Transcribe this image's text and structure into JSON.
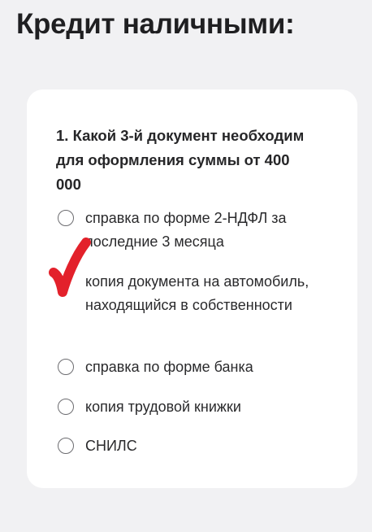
{
  "header": {
    "title": "Кредит наличными:"
  },
  "question": {
    "text": "1. Какой 3-й документ необходим для оформления суммы от 400 000",
    "options": [
      {
        "label": "справка по форме 2-НДФЛ за последние 3 месяца",
        "selected": false
      },
      {
        "label": "копия документа на автомобиль, находящийся в собственности",
        "selected": true
      },
      {
        "label": "справка по форме банка",
        "selected": false
      },
      {
        "label": "копия трудовой книжки",
        "selected": false
      },
      {
        "label": "СНИЛС",
        "selected": false
      }
    ]
  },
  "annotation": {
    "icon": "red-checkmark-icon",
    "color": "#e3212b"
  }
}
